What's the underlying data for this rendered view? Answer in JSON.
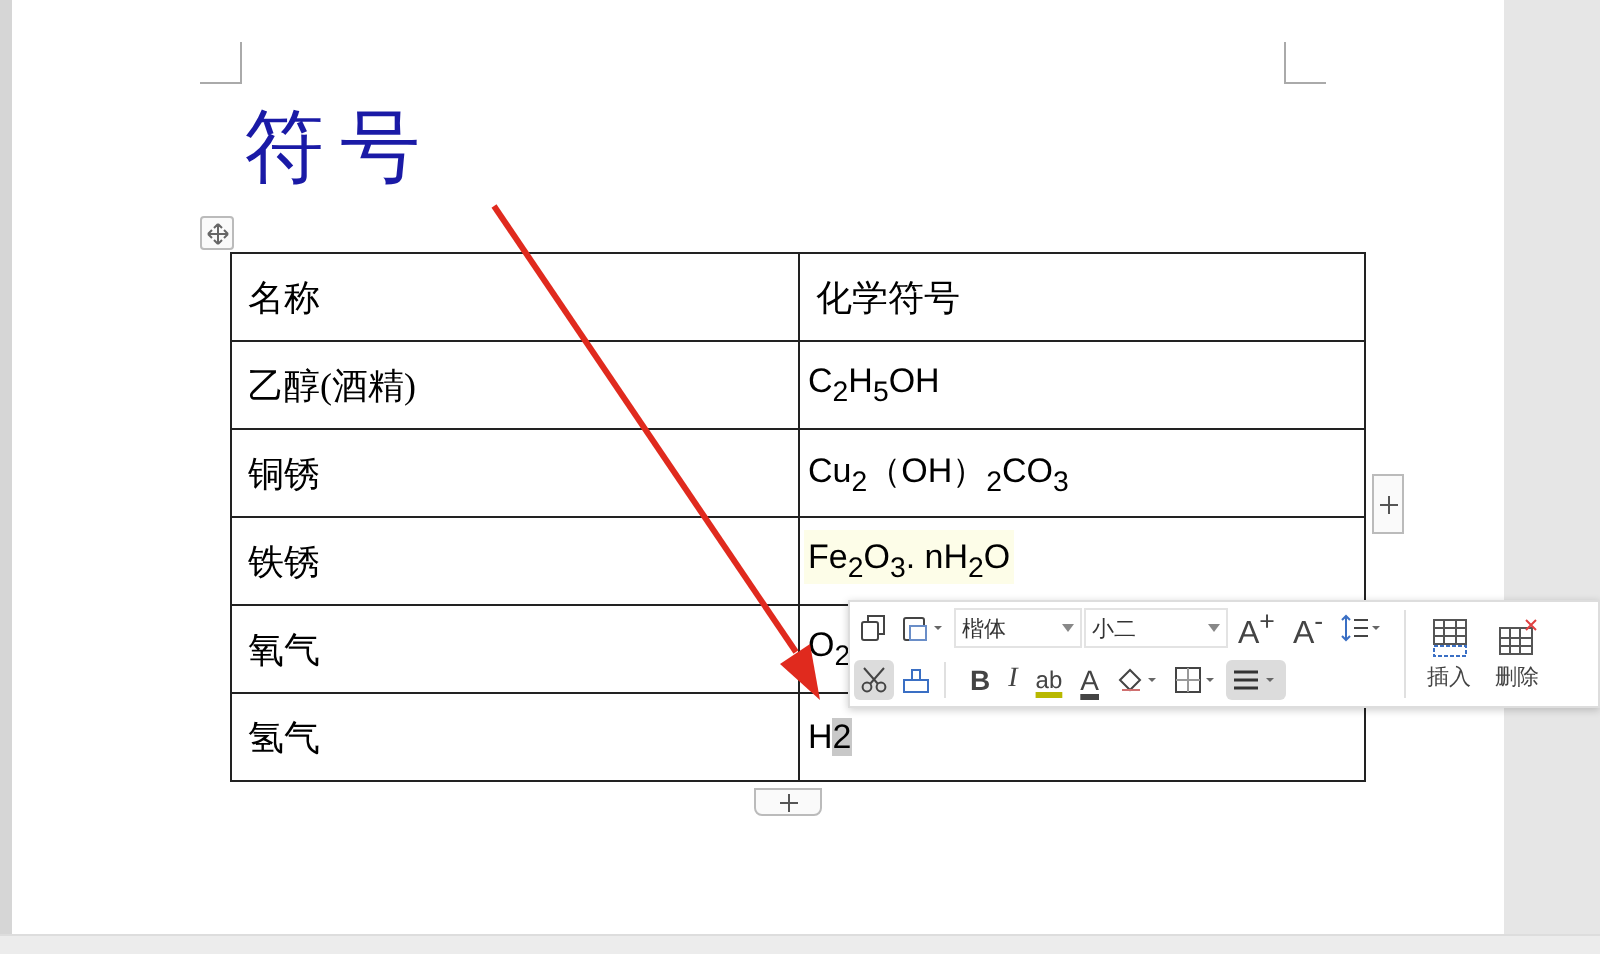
{
  "title": "符号",
  "table": {
    "columns": [
      "名称",
      "化学符号"
    ],
    "rows": [
      {
        "name": "乙醇(酒精)",
        "highlighted": false,
        "formula": [
          {
            "text": "C$_{2}$H$_{5}$OH",
            "selected": false
          }
        ]
      },
      {
        "name": "铜锈",
        "highlighted": false,
        "formula": [
          {
            "text": "Cu$_{2}$（OH）$_{2}$CO$_{3}$",
            "selected": false
          }
        ]
      },
      {
        "name": "铁锈",
        "highlighted": true,
        "formula": [
          {
            "text": "Fe$_{2}$O$_{3}$. nH$_{2}$O",
            "selected": false
          }
        ]
      },
      {
        "name": "氧气",
        "highlighted": false,
        "formula": [
          {
            "text": "O$_{2}$",
            "selected": false
          }
        ]
      },
      {
        "name": "氢气",
        "highlighted": false,
        "formula": [
          {
            "text": "H",
            "selected": false
          },
          {
            "text": "2",
            "selected": true
          }
        ]
      }
    ]
  },
  "toolbar": {
    "font": "楷体",
    "size": "小二",
    "grow_label": "A$^{+}$",
    "shrink_label": "A$^{-}$",
    "bold_label": "B",
    "italic_label": "I",
    "highlight_label": "ab",
    "color_label": "A",
    "insert_label": "插入",
    "delete_label": "删除",
    "cut_active": true,
    "align_active": true
  }
}
